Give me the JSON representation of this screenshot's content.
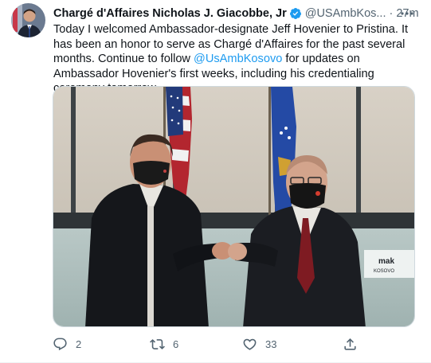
{
  "tweet": {
    "author_name": "Chargé d'Affaires Nicholas J. Giacobbe, Jr",
    "handle": "@USAmbKos...",
    "dot": "·",
    "time": "27m",
    "text_part1": "Today I welcomed Ambassador-designate Jeff Hovenier to Pristina. It has been an honor to serve as Chargé d'Affaires for the past several months. Continue to follow ",
    "mention": "@UsAmbKosovo",
    "text_part2": " for updates on Ambassador Hovenier's first weeks, including his credentialing ceremony tomorrow.",
    "sign_text": "Ambasada\nKOSOVO"
  },
  "actions": {
    "reply_count": "2",
    "retweet_count": "6",
    "like_count": "33"
  },
  "colors": {
    "accent": "#1d9bf0",
    "muted": "#536471",
    "verified": "#1d9bf0"
  },
  "icons": [
    "verified-badge-icon",
    "more-icon",
    "reply-icon",
    "retweet-icon",
    "like-icon",
    "share-icon"
  ]
}
